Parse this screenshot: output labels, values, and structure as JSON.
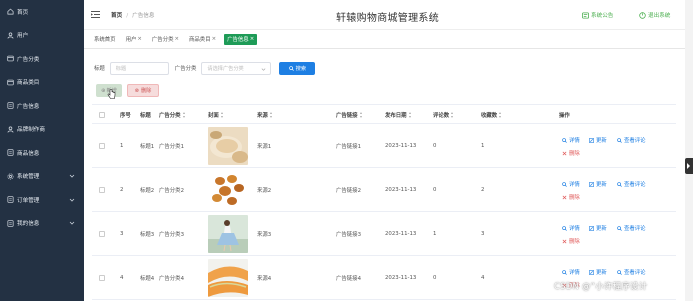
{
  "sidebar": {
    "items": [
      {
        "label": "首页",
        "icon": "home-icon"
      },
      {
        "label": "用户",
        "icon": "user-icon"
      },
      {
        "label": "广告分类",
        "icon": "category-icon"
      },
      {
        "label": "商品类目",
        "icon": "category-icon"
      },
      {
        "label": "广告信息",
        "icon": "document-icon"
      },
      {
        "label": "品牌制作商",
        "icon": "user-icon"
      },
      {
        "label": "商品信息",
        "icon": "document-icon"
      },
      {
        "label": "系统管理",
        "icon": "settings-icon",
        "expandable": true
      },
      {
        "label": "订单管理",
        "icon": "document-icon",
        "expandable": true
      },
      {
        "label": "我的信息",
        "icon": "document-icon",
        "expandable": true
      }
    ]
  },
  "header": {
    "breadcrumb_home": "首页",
    "breadcrumb_current": "广告信息",
    "title": "轩辕购物商城管理系统",
    "notice_label": "系统公告",
    "logout_label": "退出系统",
    "accent_color": "#4caf50"
  },
  "tabs": [
    {
      "label": "系统首页",
      "closable": false,
      "active": false
    },
    {
      "label": "用户",
      "closable": true,
      "active": false
    },
    {
      "label": "广告分类",
      "closable": true,
      "active": false
    },
    {
      "label": "商品类目",
      "closable": true,
      "active": false
    },
    {
      "label": "广告信息",
      "closable": true,
      "active": true
    }
  ],
  "search": {
    "title_label": "标题",
    "title_placeholder": "标题",
    "category_label": "广告分类",
    "category_placeholder": "请选择广告分类",
    "search_button": "搜索"
  },
  "actions": {
    "add_label": "新增",
    "delete_label": "删除"
  },
  "table": {
    "columns": [
      "序号",
      "标题",
      "广告分类",
      "封面",
      "来源",
      "广告链接",
      "发布日期",
      "评论数",
      "收藏数",
      "操作"
    ],
    "rows": [
      {
        "index": "1",
        "title": "标题1",
        "category": "广告分类1",
        "source": "来源1",
        "link": "广告链接1",
        "date": "2023-11-13",
        "comments": "0",
        "favorites": "1",
        "image": "bread"
      },
      {
        "index": "2",
        "title": "标题2",
        "category": "广告分类2",
        "source": "来源2",
        "link": "广告链接2",
        "date": "2023-11-13",
        "comments": "0",
        "favorites": "2",
        "image": "fried"
      },
      {
        "index": "3",
        "title": "标题3",
        "category": "广告分类3",
        "source": "来源3",
        "link": "广告链接3",
        "date": "2023-11-13",
        "comments": "1",
        "favorites": "3",
        "image": "dress"
      },
      {
        "index": "4",
        "title": "标题4",
        "category": "广告分类4",
        "source": "来源4",
        "link": "广告链接4",
        "date": "2023-11-13",
        "comments": "0",
        "favorites": "4",
        "image": "melon"
      }
    ],
    "op_detail": "详情",
    "op_edit": "更新",
    "op_comments": "查看评论",
    "op_delete": "删除"
  },
  "watermark": "CSDN @“小许程序设计"
}
